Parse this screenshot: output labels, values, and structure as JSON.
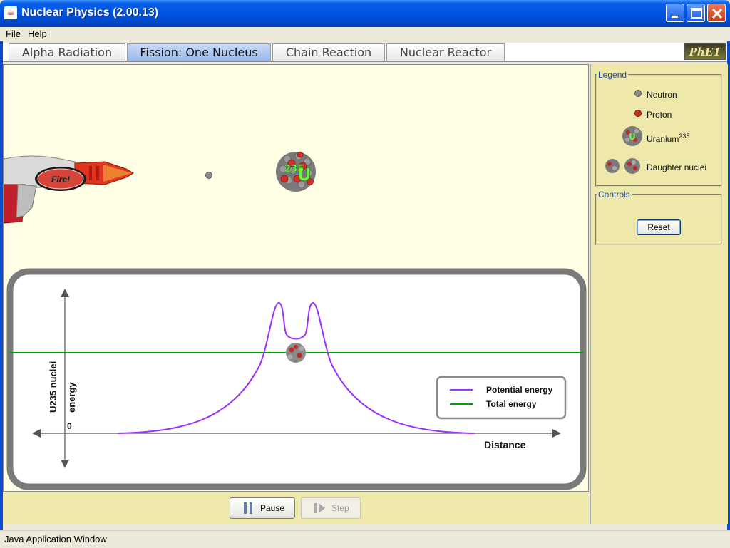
{
  "window": {
    "title": "Nuclear Physics (2.00.13)",
    "app_icon": "java-cup-icon",
    "buttons": [
      "minimize-icon",
      "maximize-icon",
      "close-icon"
    ]
  },
  "menu": {
    "items": [
      "File",
      "Help"
    ]
  },
  "tabs": [
    {
      "label": "Alpha Radiation",
      "active": false
    },
    {
      "label": "Fission: One Nucleus",
      "active": true
    },
    {
      "label": "Chain Reaction",
      "active": false
    },
    {
      "label": "Nuclear Reactor",
      "active": false
    }
  ],
  "logo": {
    "text": "PhET"
  },
  "gun": {
    "fire_label": "Fire!"
  },
  "nucleus": {
    "label": "235",
    "symbol": "U"
  },
  "energy_chart": {
    "y_label_line1": "U235 nuclei",
    "y_label_line2": "energy",
    "zero_label": "0",
    "x_label": "Distance",
    "legend": {
      "potential": "Potential energy",
      "total": "Total energy"
    },
    "colors": {
      "potential": "#9B30FF",
      "total": "#00A000"
    }
  },
  "legend_panel": {
    "title": "Legend",
    "items": [
      {
        "icon": "neutron-icon",
        "label": "Neutron"
      },
      {
        "icon": "proton-icon",
        "label": "Proton"
      },
      {
        "icon": "uranium-icon",
        "label": "Uranium",
        "sup": "235"
      },
      {
        "icon": "daughter-nuclei-icon",
        "label": "Daughter nuclei"
      }
    ]
  },
  "controls_panel": {
    "title": "Controls",
    "reset_label": "Reset"
  },
  "clock_controls": {
    "pause_label": "Pause",
    "step_label": "Step",
    "step_enabled": false
  },
  "status": {
    "text": "Java Application Window"
  }
}
